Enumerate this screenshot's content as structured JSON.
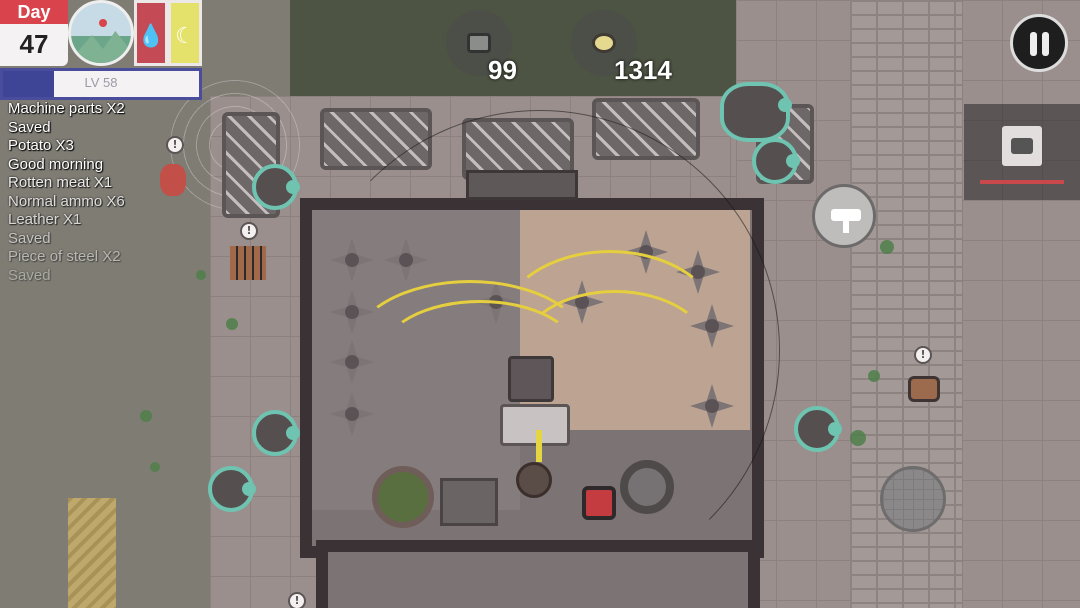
{
  "hud": {
    "day_label": "Day",
    "day_number": "47",
    "level_label": "LV 58",
    "xp_progress": 0.26,
    "status_icons": [
      "time-of-day-dial-icon",
      "blood-drop-icon",
      "hunger-moon-icon"
    ]
  },
  "resources": {
    "parts_count": "99",
    "food_count": "1314"
  },
  "log": [
    "Machine parts X2",
    "Saved",
    "Potato X3",
    "Good morning",
    "Rotten meat X1",
    "Normal ammo X6",
    "Leather X1",
    "Saved",
    "Piece of steel  X2",
    "Saved"
  ],
  "log_fade": [
    1,
    1,
    1,
    1,
    0.85,
    0.75,
    0.7,
    0.55,
    0.45,
    0.35
  ],
  "controls": {
    "pause_icon": "pause-icon",
    "weapon_icon": "handgun-icon",
    "action_icon": "hammer-icon",
    "joystick": "move-joystick"
  },
  "colors": {
    "day_header": "#d9434c",
    "xp_fill": "#3e4597",
    "blood": "#c44a55",
    "hunger": "#e4e26a",
    "zombie_outline": "#6fc3b1",
    "cable": "#e6cf3e"
  }
}
